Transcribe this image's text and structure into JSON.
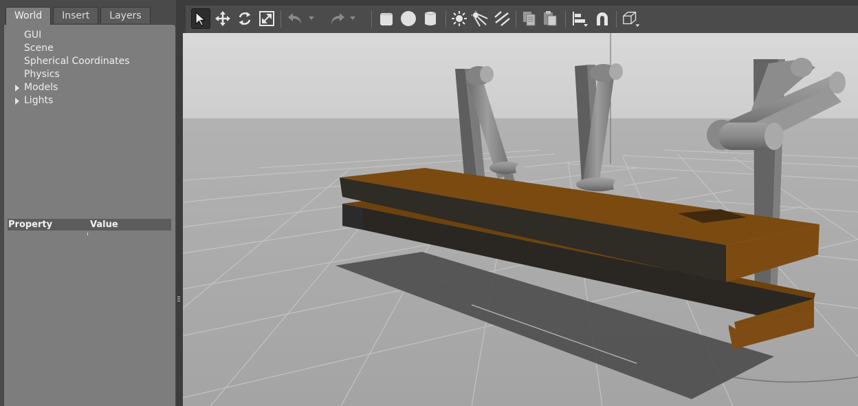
{
  "left_panel": {
    "tabs": [
      {
        "label": "World",
        "active": true
      },
      {
        "label": "Insert",
        "active": false
      },
      {
        "label": "Layers",
        "active": false
      }
    ],
    "tree": [
      {
        "label": "GUI",
        "expandable": false
      },
      {
        "label": "Scene",
        "expandable": false
      },
      {
        "label": "Spherical Coordinates",
        "expandable": false
      },
      {
        "label": "Physics",
        "expandable": false
      },
      {
        "label": "Models",
        "expandable": true
      },
      {
        "label": "Lights",
        "expandable": true
      }
    ],
    "properties": {
      "col_property": "Property",
      "col_value": "Value"
    }
  },
  "toolbar": {
    "tools": [
      "select-arrow-icon",
      "translate-icon",
      "rotate-icon",
      "scale-icon",
      "undo-icon",
      "redo-icon",
      "box-icon",
      "sphere-icon",
      "cylinder-icon",
      "point-light-icon",
      "spot-light-icon",
      "directional-light-icon",
      "copy-icon",
      "paste-icon",
      "align-icon",
      "snap-magnet-icon",
      "view-angle-icon"
    ],
    "active_tool": "select-arrow-icon"
  },
  "scene": {
    "description_colors": {
      "sky": "#d4d4d4",
      "ground": "#aaaaaa",
      "grid": "#c4c4c4",
      "beam": "#7a4a10",
      "robot_link": "#8c8c8c",
      "pillar": "#6e6e6e"
    }
  }
}
